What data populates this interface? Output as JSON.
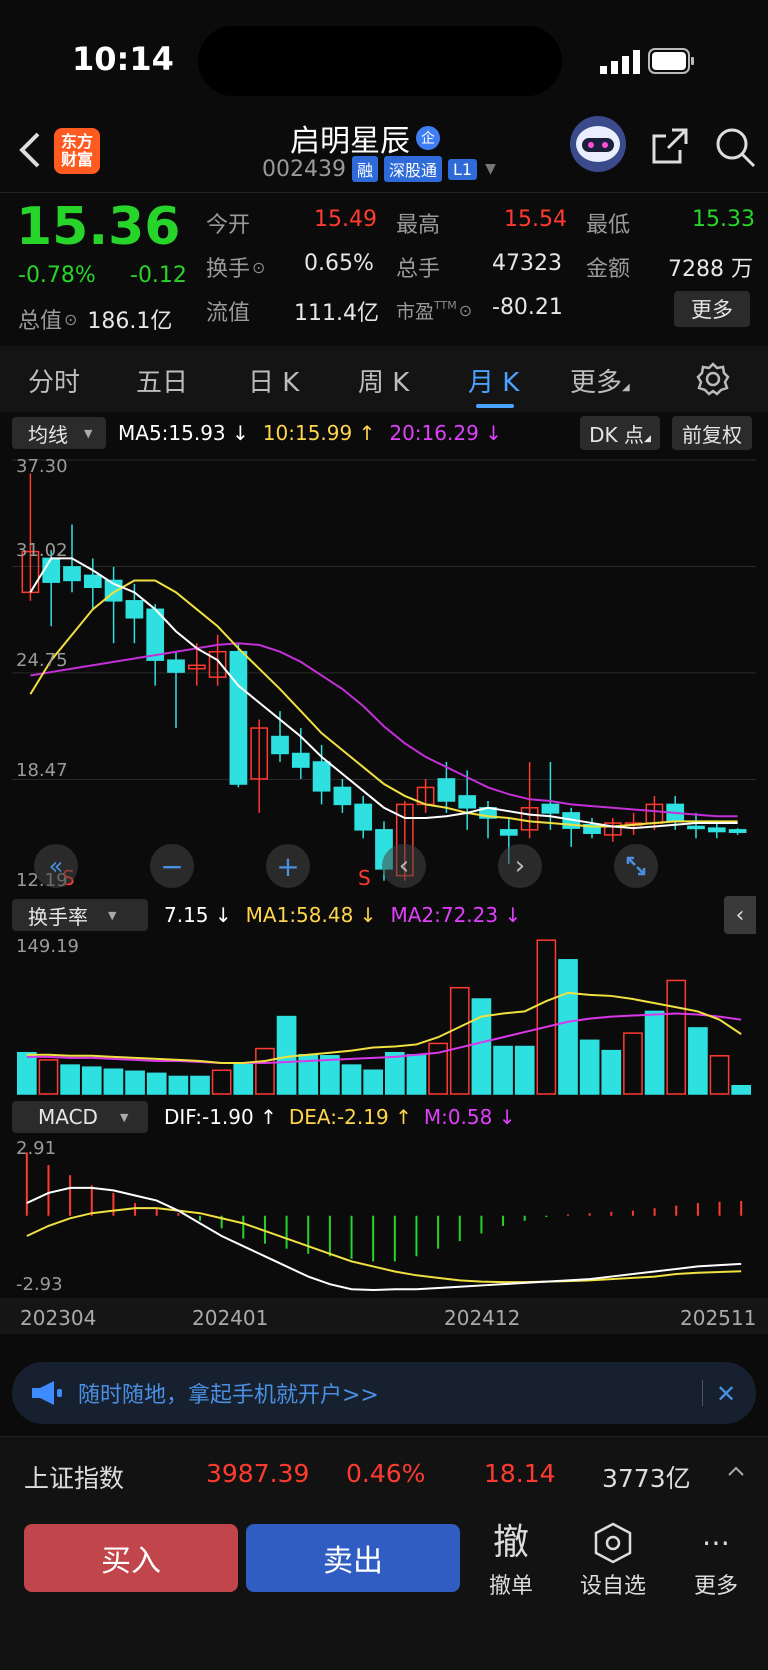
{
  "status": {
    "time": "10:14"
  },
  "header": {
    "app_logo": "东方财富",
    "title": "启明星辰",
    "title_badge": "企",
    "code": "002439",
    "tags": [
      "融",
      "深股通",
      "L1"
    ]
  },
  "quote": {
    "price": "15.36",
    "change_pct": "-0.78%",
    "change_abs": "-0.12",
    "open_label": "今开",
    "open_val": "15.49",
    "high_label": "最高",
    "high_val": "15.54",
    "low_label": "最低",
    "low_val": "15.33",
    "turnover_label": "换手",
    "turnover_val": "0.65%",
    "volume_label": "总手",
    "volume_val": "47323",
    "amount_label": "金额",
    "amount_val": "7288 万",
    "mcap_label": "总值",
    "mcap_val": "186.1亿",
    "float_label": "流值",
    "float_val": "111.4亿",
    "pe_label": "市盈",
    "pe_val": "-80.21",
    "more": "更多"
  },
  "tabs": [
    {
      "label": "分时"
    },
    {
      "label": "五日"
    },
    {
      "label": "日 K"
    },
    {
      "label": "周 K"
    },
    {
      "label": "月 K"
    },
    {
      "label": "更多"
    }
  ],
  "ma_bar": {
    "selector": "均线",
    "ma5": "MA5:15.93 ↓",
    "ma10": "10:15.99 ↑",
    "ma20": "20:16.29 ↓",
    "dk": "DK 点",
    "fq": "前复权"
  },
  "kline": {
    "y_ticks": [
      "37.30",
      "31.02",
      "24.75",
      "18.47",
      "12.19"
    ]
  },
  "turnover_bar": {
    "selector": "换手率",
    "val": "7.15 ↓",
    "ma1": "MA1:58.48 ↓",
    "ma2": "MA2:72.23 ↓",
    "max": "149.19"
  },
  "macd_bar": {
    "selector": "MACD",
    "dif": "DIF:-1.90 ↑",
    "dea": "DEA:-2.19 ↑",
    "m": "M:0.58 ↓",
    "max": "2.91",
    "min": "-2.93"
  },
  "x_axis": [
    "202304",
    "202401",
    "202412",
    "202511"
  ],
  "banner": {
    "text": "随时随地，拿起手机就开户>>"
  },
  "index_bar": {
    "name": "上证指数",
    "price": "3987.39",
    "pct": "0.46%",
    "chg": "18.14",
    "amount": "3773亿"
  },
  "bottom": {
    "buy": "买入",
    "sell": "卖出",
    "cancel_glyph": "撤",
    "cancel": "撤单",
    "watch": "设自选",
    "more": "更多"
  },
  "chart_data": {
    "type": "candlestick",
    "categories": [
      "202304",
      "202401",
      "202412",
      "202511"
    ],
    "candles": [
      {
        "o": 29.5,
        "h": 36.5,
        "l": 29.0,
        "c": 31.9
      },
      {
        "o": 31.5,
        "h": 32.0,
        "l": 27.5,
        "c": 30.1
      },
      {
        "o": 31.0,
        "h": 33.5,
        "l": 29.5,
        "c": 30.2
      },
      {
        "o": 30.5,
        "h": 31.5,
        "l": 28.5,
        "c": 29.8
      },
      {
        "o": 30.2,
        "h": 31.0,
        "l": 26.5,
        "c": 29.0
      },
      {
        "o": 29.0,
        "h": 30.0,
        "l": 26.5,
        "c": 28.0
      },
      {
        "o": 28.5,
        "h": 28.8,
        "l": 24.0,
        "c": 25.5
      },
      {
        "o": 25.5,
        "h": 26.0,
        "l": 21.5,
        "c": 24.8
      },
      {
        "o": 25.0,
        "h": 26.5,
        "l": 24.0,
        "c": 25.2
      },
      {
        "o": 24.5,
        "h": 27.0,
        "l": 24.0,
        "c": 26.0
      },
      {
        "o": 26.0,
        "h": 26.5,
        "l": 18.0,
        "c": 18.2
      },
      {
        "o": 18.5,
        "h": 22.0,
        "l": 16.5,
        "c": 21.5
      },
      {
        "o": 21.0,
        "h": 22.5,
        "l": 19.5,
        "c": 20.0
      },
      {
        "o": 20.0,
        "h": 21.5,
        "l": 18.5,
        "c": 19.2
      },
      {
        "o": 19.5,
        "h": 20.5,
        "l": 17.0,
        "c": 17.8
      },
      {
        "o": 18.0,
        "h": 18.5,
        "l": 16.5,
        "c": 17.0
      },
      {
        "o": 17.0,
        "h": 17.5,
        "l": 15.0,
        "c": 15.5
      },
      {
        "o": 15.5,
        "h": 16.0,
        "l": 12.5,
        "c": 13.2
      },
      {
        "o": 12.8,
        "h": 17.2,
        "l": 12.5,
        "c": 17.0
      },
      {
        "o": 17.0,
        "h": 18.5,
        "l": 16.5,
        "c": 18.0
      },
      {
        "o": 18.5,
        "h": 19.5,
        "l": 16.5,
        "c": 17.2
      },
      {
        "o": 17.5,
        "h": 19.0,
        "l": 15.5,
        "c": 16.8
      },
      {
        "o": 16.8,
        "h": 17.2,
        "l": 15.0,
        "c": 16.2
      },
      {
        "o": 15.5,
        "h": 16.2,
        "l": 13.5,
        "c": 15.2
      },
      {
        "o": 15.5,
        "h": 19.5,
        "l": 15.0,
        "c": 16.8
      },
      {
        "o": 17.0,
        "h": 19.5,
        "l": 15.5,
        "c": 16.5
      },
      {
        "o": 16.5,
        "h": 16.8,
        "l": 14.5,
        "c": 15.6
      },
      {
        "o": 15.8,
        "h": 16.2,
        "l": 15.0,
        "c": 15.3
      },
      {
        "o": 15.2,
        "h": 16.2,
        "l": 14.8,
        "c": 15.9
      },
      {
        "o": 15.9,
        "h": 16.5,
        "l": 15.2,
        "c": 15.9
      },
      {
        "o": 15.9,
        "h": 17.5,
        "l": 15.5,
        "c": 17.0
      },
      {
        "o": 17.0,
        "h": 17.5,
        "l": 15.5,
        "c": 16.0
      },
      {
        "o": 15.7,
        "h": 16.5,
        "l": 15.0,
        "c": 15.6
      },
      {
        "o": 15.6,
        "h": 16.0,
        "l": 15.0,
        "c": 15.4
      },
      {
        "o": 15.5,
        "h": 15.6,
        "l": 15.2,
        "c": 15.36
      }
    ],
    "ma5": [
      29.5,
      31.5,
      31.5,
      30.8,
      30.0,
      29.5,
      28.5,
      27.2,
      26.2,
      25.5,
      24.0,
      23.0,
      22.0,
      21.0,
      19.8,
      18.8,
      17.8,
      16.8,
      16.2,
      16.2,
      16.3,
      16.5,
      16.8,
      16.6,
      16.4,
      16.3,
      16.1,
      15.9,
      15.7,
      15.6,
      15.7,
      15.8,
      15.9,
      15.9,
      15.9
    ],
    "ma10": [
      23.5,
      25.5,
      27.0,
      28.5,
      29.5,
      30.2,
      30.2,
      29.5,
      28.5,
      27.5,
      26.2,
      25.0,
      23.8,
      22.5,
      21.2,
      20.2,
      19.2,
      18.2,
      17.5,
      17.0,
      16.8,
      16.5,
      16.3,
      16.2,
      16.0,
      15.9,
      15.8,
      15.7,
      15.7,
      15.8,
      15.9,
      16.0,
      16.0,
      16.0,
      16.0
    ],
    "ma20": [
      24.6,
      24.8,
      25.0,
      25.2,
      25.4,
      25.6,
      25.8,
      26.0,
      26.2,
      26.4,
      26.5,
      26.4,
      26.0,
      25.4,
      24.6,
      23.8,
      22.8,
      21.6,
      20.6,
      19.8,
      19.2,
      18.6,
      18.0,
      17.6,
      17.3,
      17.2,
      17.0,
      16.9,
      16.8,
      16.7,
      16.6,
      16.5,
      16.4,
      16.3,
      16.3
    ],
    "turnover": [
      {
        "v": 40,
        "up": false
      },
      {
        "v": 33,
        "up": true
      },
      {
        "v": 28,
        "up": false
      },
      {
        "v": 26,
        "up": false
      },
      {
        "v": 24,
        "up": false
      },
      {
        "v": 22,
        "up": false
      },
      {
        "v": 20,
        "up": false
      },
      {
        "v": 17,
        "up": false
      },
      {
        "v": 17,
        "up": false
      },
      {
        "v": 23,
        "up": true
      },
      {
        "v": 30,
        "up": false
      },
      {
        "v": 44,
        "up": true
      },
      {
        "v": 75,
        "up": false
      },
      {
        "v": 38,
        "up": false
      },
      {
        "v": 37,
        "up": false
      },
      {
        "v": 28,
        "up": false
      },
      {
        "v": 23,
        "up": false
      },
      {
        "v": 40,
        "up": false
      },
      {
        "v": 38,
        "up": false
      },
      {
        "v": 49,
        "up": true
      },
      {
        "v": 103,
        "up": true
      },
      {
        "v": 92,
        "up": false
      },
      {
        "v": 46,
        "up": false
      },
      {
        "v": 46,
        "up": false
      },
      {
        "v": 149,
        "up": true
      },
      {
        "v": 130,
        "up": false
      },
      {
        "v": 52,
        "up": false
      },
      {
        "v": 42,
        "up": false
      },
      {
        "v": 59,
        "up": true
      },
      {
        "v": 80,
        "up": false
      },
      {
        "v": 110,
        "up": true
      },
      {
        "v": 64,
        "up": false
      },
      {
        "v": 37,
        "up": true
      },
      {
        "v": 8,
        "up": false
      }
    ],
    "ma1": [
      38,
      38,
      37,
      37,
      36,
      35,
      34,
      33,
      32,
      30,
      30,
      32,
      36,
      38,
      40,
      42,
      45,
      46,
      48,
      55,
      65,
      75,
      78,
      80,
      90,
      98,
      96,
      95,
      92,
      88,
      84,
      80,
      72,
      58
    ],
    "ma2": [
      36,
      36,
      35,
      35,
      34,
      33,
      32,
      32,
      31,
      30,
      30,
      30,
      31,
      32,
      33,
      34,
      35,
      36,
      38,
      40,
      45,
      50,
      55,
      60,
      65,
      70,
      73,
      75,
      76,
      77,
      78,
      77,
      75,
      72
    ],
    "macd": [
      2.5,
      2.0,
      1.6,
      1.2,
      0.9,
      0.5,
      0.3,
      0.1,
      -0.2,
      -0.5,
      -0.9,
      -1.1,
      -1.3,
      -1.5,
      -1.6,
      -1.7,
      -1.8,
      -1.8,
      -1.6,
      -1.3,
      -1.0,
      -0.7,
      -0.4,
      -0.2,
      -0.05,
      0.05,
      0.1,
      0.15,
      0.2,
      0.3,
      0.4,
      0.5,
      0.55,
      0.58
    ],
    "dif": [
      0.5,
      0.9,
      1.1,
      1.1,
      1.0,
      0.8,
      0.6,
      0.2,
      -0.3,
      -0.8,
      -1.2,
      -1.6,
      -2.0,
      -2.4,
      -2.7,
      -2.9,
      -2.93,
      -2.9,
      -2.9,
      -2.85,
      -2.8,
      -2.75,
      -2.7,
      -2.65,
      -2.6,
      -2.55,
      -2.5,
      -2.4,
      -2.3,
      -2.2,
      -2.1,
      -2.0,
      -1.95,
      -1.9
    ],
    "dea": [
      -0.8,
      -0.4,
      -0.1,
      0.1,
      0.2,
      0.3,
      0.3,
      0.2,
      0.1,
      -0.1,
      -0.3,
      -0.6,
      -0.9,
      -1.2,
      -1.5,
      -1.8,
      -2.0,
      -2.2,
      -2.35,
      -2.45,
      -2.55,
      -2.6,
      -2.62,
      -2.62,
      -2.6,
      -2.58,
      -2.55,
      -2.5,
      -2.45,
      -2.4,
      -2.3,
      -2.25,
      -2.22,
      -2.19
    ]
  }
}
